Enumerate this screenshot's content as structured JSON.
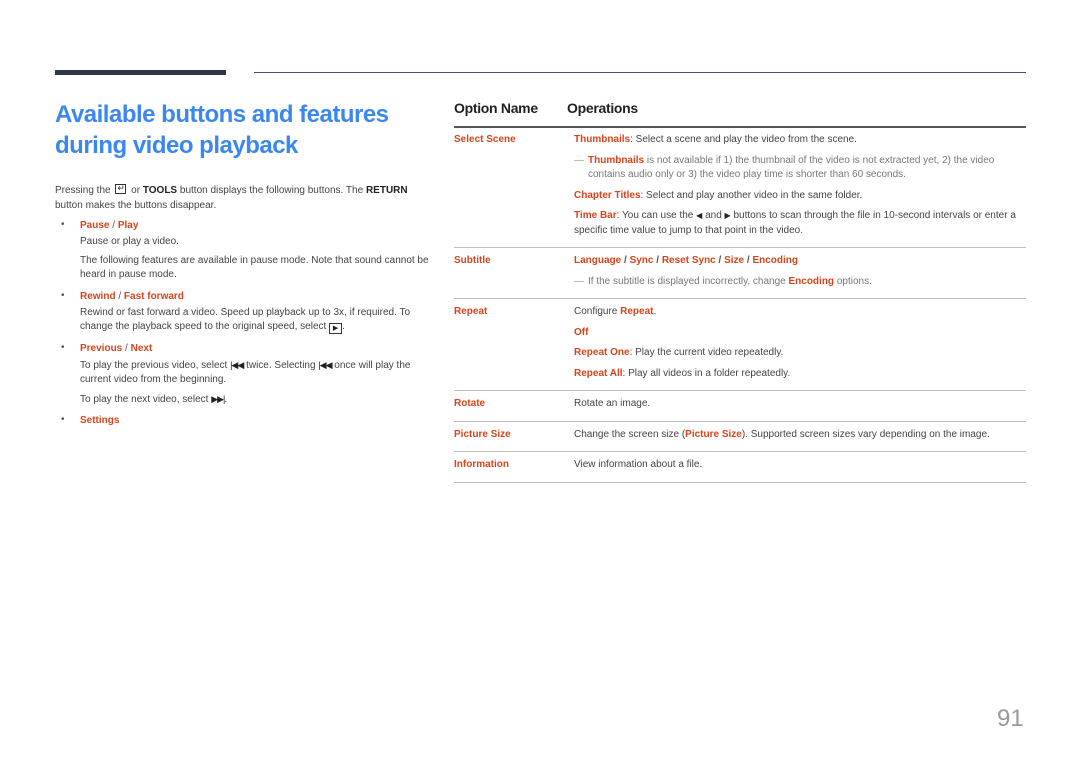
{
  "page": {
    "title": "Available buttons and features during video playback",
    "page_number": "91"
  },
  "intro": {
    "part1": "Pressing the",
    "icon": "return-tools-icon",
    "part2": "or",
    "tools": "TOOLS",
    "part3": "button displays the following buttons. The",
    "return": "RETURN",
    "part4": "button makes the buttons disappear."
  },
  "bullets": [
    {
      "title_a": "Pause",
      "sep": " / ",
      "title_b": "Play",
      "lines": [
        "Pause or play a video.",
        "The following features are available in pause mode. Note that sound cannot be heard in pause mode."
      ]
    },
    {
      "title_a": "Rewind",
      "sep": " / ",
      "title_b": "Fast forward",
      "line1": "Rewind or fast forward a video. Speed up playback up to 3x, if required. To change the playback speed to the original speed, select",
      "line1_icon": "play-icon",
      "line1_end": "."
    },
    {
      "title_a": "Previous",
      "sep": " / ",
      "title_b": "Next",
      "l1a": "To play the previous video, select",
      "l1b": "twice. Selecting",
      "l1c": "once will play the current video from the beginning.",
      "l2a": "To play the next video, select",
      "l2b": ".",
      "prev_icon": "previous-icon",
      "next_icon": "next-icon"
    },
    {
      "title_a": "Settings"
    }
  ],
  "table": {
    "headers": [
      "Option Name",
      "Operations"
    ],
    "rows": {
      "select_scene": {
        "name": "Select Scene",
        "thumb_label": "Thumbnails",
        "thumb_text": ": Select a scene and play the video from the scene.",
        "note_label": "Thumbnails",
        "note_text": " is not available if 1) the thumbnail of the video is not extracted yet, 2) the video contains audio only or 3) the video play time is shorter than 60 seconds.",
        "chapter_label": "Chapter Titles",
        "chapter_text": ": Select and play another video in the same folder.",
        "timebar_label": "Time Bar",
        "timebar_a": ": You can use the",
        "timebar_b": "and",
        "timebar_c": "buttons to scan through the file in 10-second intervals or enter a specific time value to jump to that point in the video."
      },
      "subtitle": {
        "name": "Subtitle",
        "options": [
          "Language",
          "Sync",
          "Reset Sync",
          "Size",
          "Encoding"
        ],
        "sep": " / ",
        "note_a": "If the subtitle is displayed incorrectly, change ",
        "note_label": "Encoding",
        "note_b": " options."
      },
      "repeat": {
        "name": "Repeat",
        "config_a": "Configure ",
        "config_label": "Repeat",
        "config_b": ".",
        "off": "Off",
        "one_label": "Repeat One",
        "one_text": ": Play the current video repeatedly.",
        "all_label": "Repeat All",
        "all_text": ": Play all videos in a folder repeatedly."
      },
      "rotate": {
        "name": "Rotate",
        "text": "Rotate an image."
      },
      "picture_size": {
        "name": "Picture Size",
        "text_a": "Change the screen size (",
        "label": "Picture Size",
        "text_b": "). Supported screen sizes vary depending on the image."
      },
      "information": {
        "name": "Information",
        "text": "View information about a file."
      }
    }
  },
  "colors": {
    "title_blue": "#3b87f0",
    "accent_red": "#d9431a",
    "dark_bar": "#2f3548"
  }
}
